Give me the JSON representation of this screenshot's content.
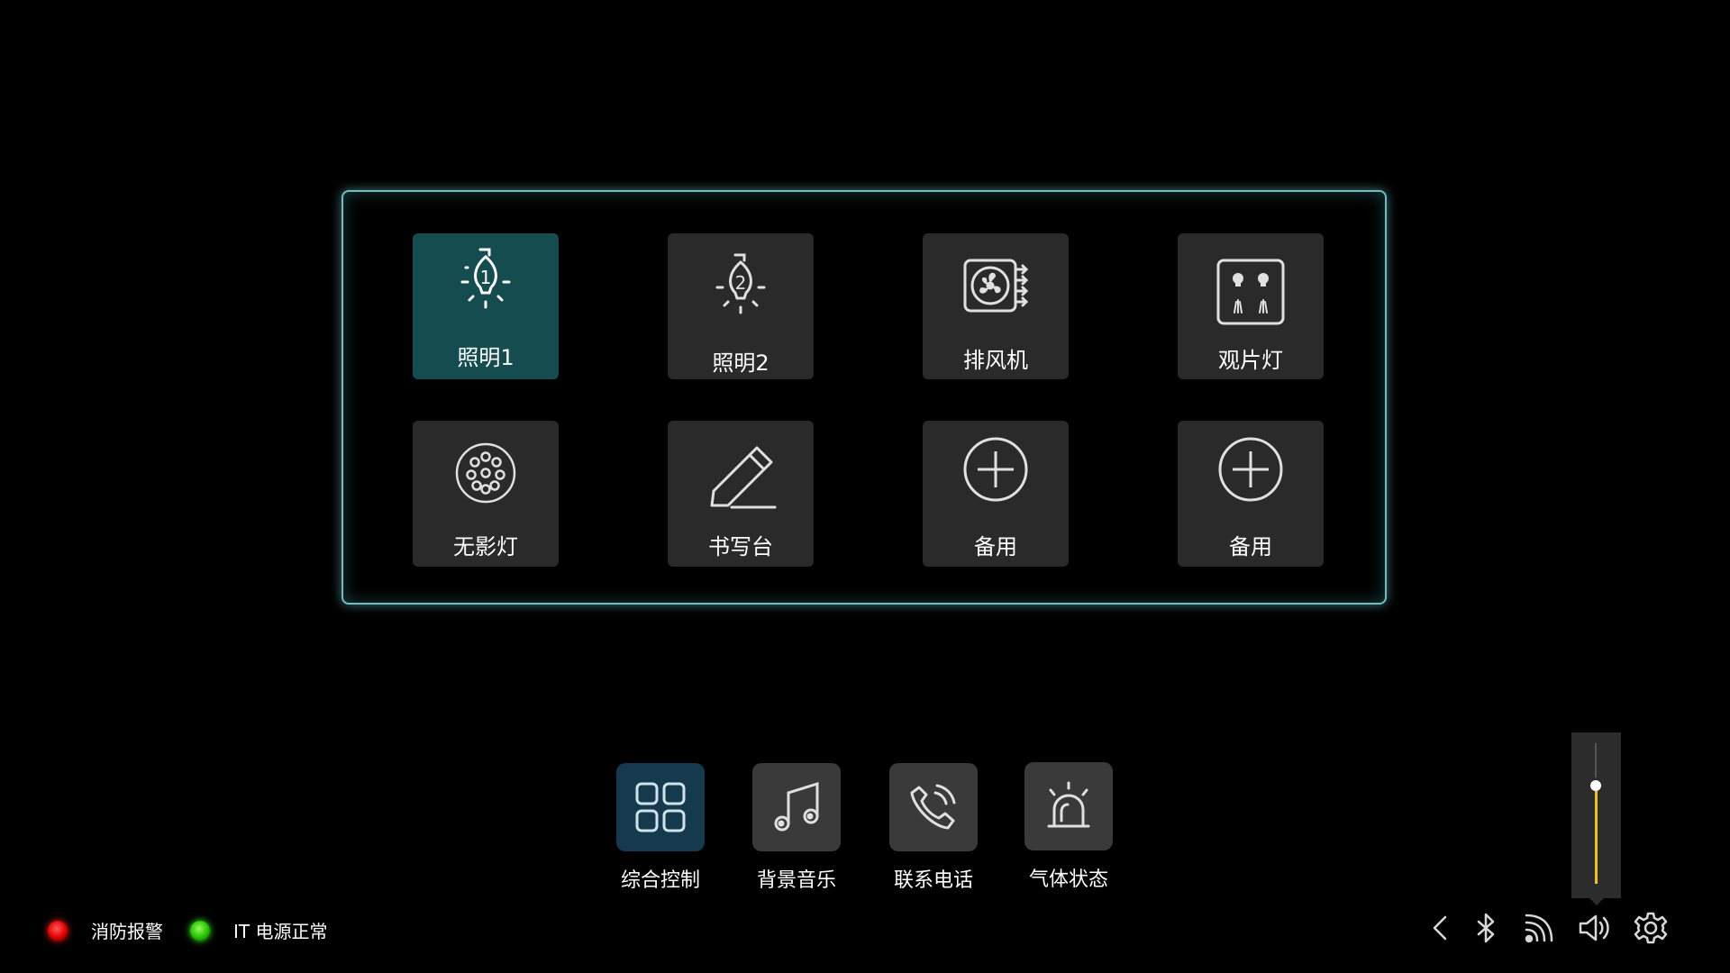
{
  "grid": {
    "tiles": [
      {
        "label": "照明1",
        "icon": "bulb-1-icon",
        "active": true
      },
      {
        "label": "照明2",
        "icon": "bulb-2-icon",
        "active": false
      },
      {
        "label": "排风机",
        "icon": "exhaust-fan-icon",
        "active": false
      },
      {
        "label": "观片灯",
        "icon": "film-viewer-icon",
        "active": false
      },
      {
        "label": "无影灯",
        "icon": "shadowless-lamp-icon",
        "active": false
      },
      {
        "label": "书写台",
        "icon": "pencil-icon",
        "active": false
      },
      {
        "label": "备用",
        "icon": "plus-icon",
        "active": false
      },
      {
        "label": "备用",
        "icon": "plus-icon",
        "active": false
      }
    ]
  },
  "dock": {
    "items": [
      {
        "label": "综合控制",
        "icon": "grid-icon",
        "active": true
      },
      {
        "label": "背景音乐",
        "icon": "music-note-icon",
        "active": false
      },
      {
        "label": "联系电话",
        "icon": "phone-icon",
        "active": false
      },
      {
        "label": "气体状态",
        "icon": "alarm-siren-icon",
        "active": false
      }
    ]
  },
  "status": {
    "fire_alarm": {
      "label": "消防报警",
      "color": "#e00000"
    },
    "it_power": {
      "label": "IT 电源正常",
      "color": "#26c000"
    }
  },
  "volume": {
    "level": 0.74,
    "accent": "#f0c020"
  },
  "tray": {
    "icons": [
      "back-icon",
      "bluetooth-icon",
      "wifi-icon",
      "speaker-icon",
      "settings-icon"
    ]
  },
  "theme": {
    "active_tile": "#144c4f",
    "panel_border": "#6fbfc1",
    "tile_bg": "#2a2a2a"
  }
}
